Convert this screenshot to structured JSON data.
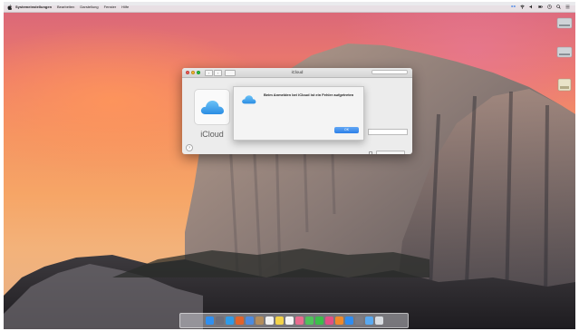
{
  "menubar": {
    "app_name": "Systemeinstellungen",
    "menus": [
      "Bearbeiten",
      "Darstellung",
      "Fenster",
      "Hilfe"
    ],
    "status_icons": [
      "dropbox-icon",
      "wifi-icon",
      "volume-icon",
      "battery-icon",
      "clock-icon",
      "spotlight-icon",
      "notification-center-icon"
    ]
  },
  "desktop_icons": [
    {
      "label": "",
      "icon": "hard-drive-icon"
    },
    {
      "label": "",
      "icon": "hard-drive-icon"
    },
    {
      "label": "",
      "icon": "disk-image-icon"
    }
  ],
  "window": {
    "title": "iCloud",
    "search_placeholder": "",
    "icloud_name": "iCloud",
    "link_left": "",
    "link_right": "",
    "bg_text": "",
    "button_label": ""
  },
  "alert": {
    "title": "Beim Anmelden bei iCloud ist ein Fehler aufgetreten",
    "message": "",
    "ok_label": "OK"
  },
  "dock": {
    "items": [
      {
        "name": "finder-icon",
        "color": "#2f8ff0"
      },
      {
        "name": "launchpad-icon",
        "color": "#6f6f7a"
      },
      {
        "name": "safari-icon",
        "color": "#2f9be8"
      },
      {
        "name": "firefox-icon",
        "color": "#e2632a"
      },
      {
        "name": "mail-icon",
        "color": "#4c8be0"
      },
      {
        "name": "contacts-icon",
        "color": "#b38d5c"
      },
      {
        "name": "calendar-icon",
        "color": "#f2f2f2"
      },
      {
        "name": "notes-icon",
        "color": "#f3d34a"
      },
      {
        "name": "reminders-icon",
        "color": "#f5f5f5"
      },
      {
        "name": "photos-icon",
        "color": "#e96b8e"
      },
      {
        "name": "messages-icon",
        "color": "#4fc25b"
      },
      {
        "name": "facetime-icon",
        "color": "#3bbf4a"
      },
      {
        "name": "itunes-icon",
        "color": "#e24f86"
      },
      {
        "name": "ibooks-icon",
        "color": "#f08a2a"
      },
      {
        "name": "app-store-icon",
        "color": "#2f8cf0"
      },
      {
        "name": "system-preferences-icon",
        "color": "#7d7d85"
      },
      {
        "name": "downloads-folder-icon",
        "color": "#5aa9f0"
      },
      {
        "name": "trash-icon",
        "color": "#d9dde2"
      }
    ]
  }
}
